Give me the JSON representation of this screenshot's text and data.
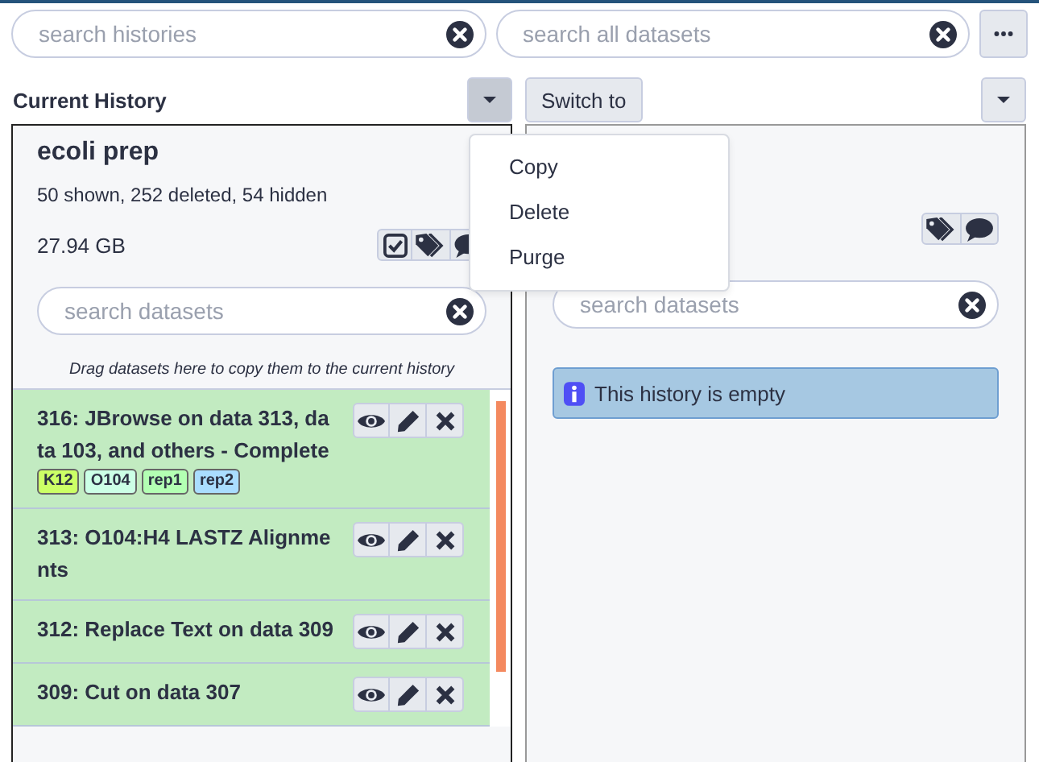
{
  "search_histories": {
    "placeholder": "search histories"
  },
  "search_all": {
    "placeholder": "search all datasets"
  },
  "current_history": {
    "label": "Current History",
    "name": "ecoli prep",
    "stats": "50 shown, 252 deleted, 54 hidden",
    "size": "27.94 GB",
    "search": {
      "placeholder": "search datasets"
    },
    "drop_hint": "Drag datasets here to copy them to the current history",
    "datasets": [
      {
        "title": "316: JBrowse on data 313, data 103, and others - Complete",
        "kind": "ok",
        "tags": [
          {
            "label": "K12",
            "color": "#ccff66"
          },
          {
            "label": "O104",
            "color": "#ccffe6"
          },
          {
            "label": "rep1",
            "color": "#b3ffb3"
          },
          {
            "label": "rep2",
            "color": "#aaddff"
          }
        ]
      },
      {
        "title": "313: O104:H4 LASTZ Alignments",
        "kind": "ok"
      },
      {
        "title": "312: Replace Text on data 309",
        "kind": "ok"
      },
      {
        "title": "309: Cut on data 307",
        "kind": "ok"
      }
    ]
  },
  "switch_button": {
    "label": "Switch to"
  },
  "menu": {
    "items": [
      "Copy",
      "Delete",
      "Purge"
    ]
  },
  "other_history": {
    "search": {
      "placeholder": "search datasets"
    },
    "message": "This history is empty"
  }
}
